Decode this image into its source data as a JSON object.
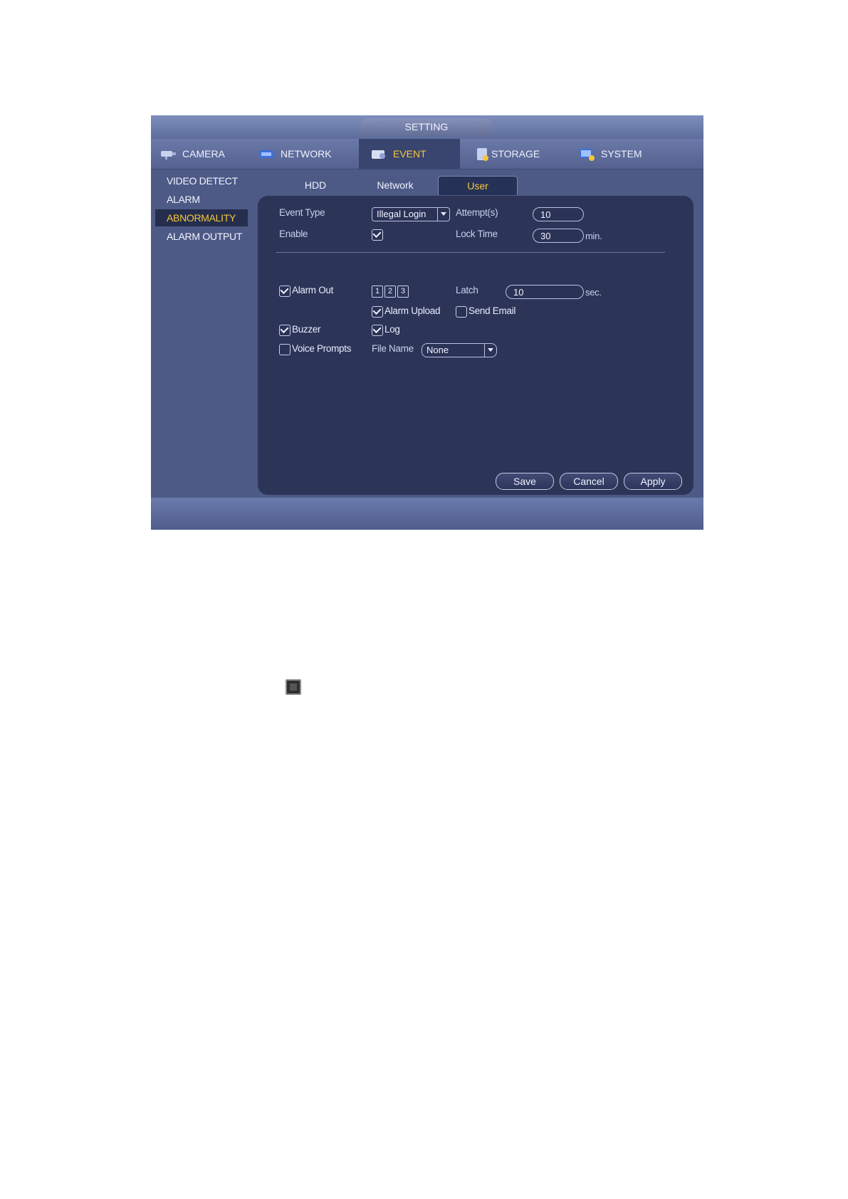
{
  "window": {
    "title": "SETTING"
  },
  "tabs": [
    {
      "label": "CAMERA",
      "icon": "camera-icon"
    },
    {
      "label": "NETWORK",
      "icon": "network-icon"
    },
    {
      "label": "EVENT",
      "icon": "event-icon",
      "active": true
    },
    {
      "label": "STORAGE",
      "icon": "storage-icon"
    },
    {
      "label": "SYSTEM",
      "icon": "system-icon"
    }
  ],
  "sidebar": {
    "items": [
      {
        "label": "VIDEO DETECT"
      },
      {
        "label": "ALARM"
      },
      {
        "label": "ABNORMALITY",
        "active": true
      },
      {
        "label": "ALARM OUTPUT"
      }
    ]
  },
  "subtabs": [
    {
      "label": "HDD"
    },
    {
      "label": "Network"
    },
    {
      "label": "User",
      "active": true
    }
  ],
  "form": {
    "event_type_label": "Event Type",
    "event_type_value": "Illegal Login",
    "attempts_label": "Attempt(s)",
    "attempts_value": "10",
    "enable_label": "Enable",
    "enable_checked": true,
    "lock_time_label": "Lock Time",
    "lock_time_value": "30",
    "lock_time_unit": "min.",
    "alarm_out_label": "Alarm Out",
    "alarm_out_checked": true,
    "alarm_out_channels": [
      "1",
      "2",
      "3"
    ],
    "latch_label": "Latch",
    "latch_value": "10",
    "latch_unit": "sec.",
    "alarm_upload_label": "Alarm Upload",
    "alarm_upload_checked": true,
    "send_email_label": "Send Email",
    "send_email_checked": false,
    "buzzer_label": "Buzzer",
    "buzzer_checked": true,
    "log_label": "Log",
    "log_checked": true,
    "voice_prompts_label": "Voice Prompts",
    "voice_prompts_checked": false,
    "file_name_label": "File Name",
    "file_name_value": "None"
  },
  "buttons": {
    "save": "Save",
    "cancel": "Cancel",
    "apply": "Apply"
  },
  "colors": {
    "accent": "#f3c83a",
    "window_bg": "#4d5a86",
    "panel_bg": "#2c3558"
  }
}
